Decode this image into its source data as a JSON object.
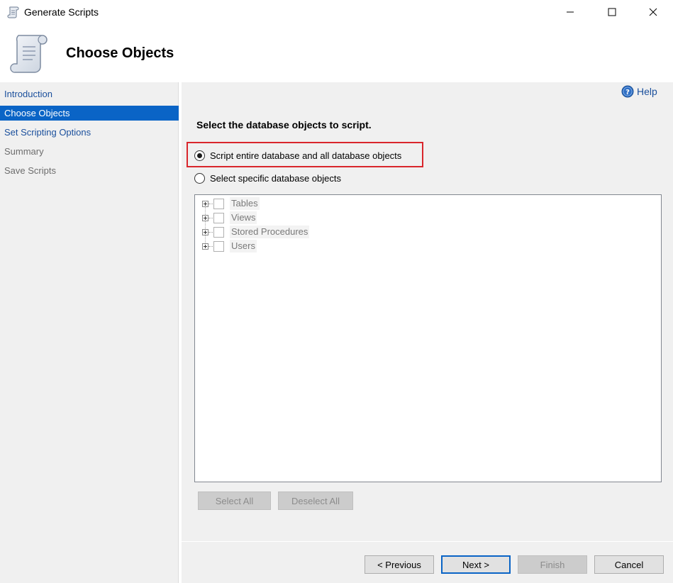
{
  "window": {
    "title": "Generate Scripts",
    "minimize_icon": "minimize-icon",
    "maximize_icon": "maximize-icon",
    "close_icon": "close-icon"
  },
  "header": {
    "heading": "Choose Objects",
    "icon": "scroll-icon"
  },
  "nav": {
    "items": [
      {
        "label": "Introduction",
        "state": "link"
      },
      {
        "label": "Choose Objects",
        "state": "active"
      },
      {
        "label": "Set Scripting Options",
        "state": "link"
      },
      {
        "label": "Summary",
        "state": "disabled"
      },
      {
        "label": "Save Scripts",
        "state": "disabled"
      }
    ]
  },
  "main": {
    "help_label": "Help",
    "instruction": "Select the database objects to script.",
    "options": [
      {
        "label": "Script entire database and all database objects",
        "checked": true
      },
      {
        "label": "Select specific database objects",
        "checked": false
      }
    ],
    "tree": [
      {
        "label": "Tables"
      },
      {
        "label": "Views"
      },
      {
        "label": "Stored Procedures"
      },
      {
        "label": "Users"
      }
    ],
    "select_all_label": "Select All",
    "deselect_all_label": "Deselect All"
  },
  "footer": {
    "previous_label": "< Previous",
    "next_label": "Next >",
    "finish_label": "Finish",
    "cancel_label": "Cancel"
  },
  "colors": {
    "accent": "#0a64c6",
    "link": "#1a4f9c",
    "highlight_border": "#d9262c",
    "panel_bg": "#f0f0f0"
  }
}
